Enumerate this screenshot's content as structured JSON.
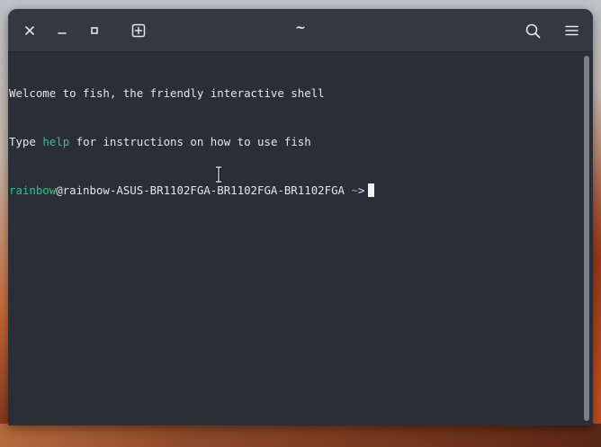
{
  "window": {
    "title": "~"
  },
  "titlebar": {
    "icons": {
      "close": "close-icon",
      "minimize": "minimize-icon",
      "maximize": "maximize-icon",
      "new_tab": "new-tab-icon",
      "search": "search-icon",
      "menu": "hamburger-menu-icon"
    }
  },
  "terminal": {
    "welcome_line": "Welcome to fish, the friendly interactive shell",
    "help_prefix": "Type ",
    "help_word": "help",
    "help_suffix": " for instructions on how to use fish",
    "prompt_user": "rainbow",
    "prompt_host": "@rainbow-ASUS-BR1102FGA-BR1102FGA-BR1102FGA",
    "prompt_path": "~",
    "prompt_symbol": ">"
  },
  "colors": {
    "terminal_bg": "#2a2e38",
    "titlebar_bg": "#343842",
    "accent_green": "#33c08a",
    "text": "#e6e6e6"
  }
}
